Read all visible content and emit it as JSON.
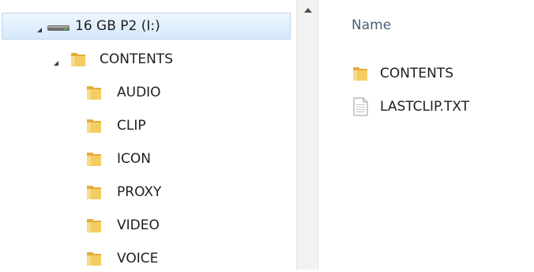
{
  "tree": {
    "drive": {
      "label": "16 GB P2 (I:)"
    },
    "contents": {
      "label": "CONTENTS"
    },
    "children": [
      {
        "label": "AUDIO"
      },
      {
        "label": "CLIP"
      },
      {
        "label": "ICON"
      },
      {
        "label": "PROXY"
      },
      {
        "label": "VIDEO"
      },
      {
        "label": "VOICE"
      }
    ]
  },
  "list": {
    "column_name": "Name",
    "items": [
      {
        "label": "CONTENTS",
        "icon": "folder-icon"
      },
      {
        "label": "LASTCLIP.TXT",
        "icon": "text-file-icon"
      }
    ]
  },
  "colors": {
    "selection_top": "#eef6fd",
    "selection_bottom": "#d6e9fb",
    "selection_border": "#b7d5f3",
    "folder_yellow": "#f1c75a"
  }
}
